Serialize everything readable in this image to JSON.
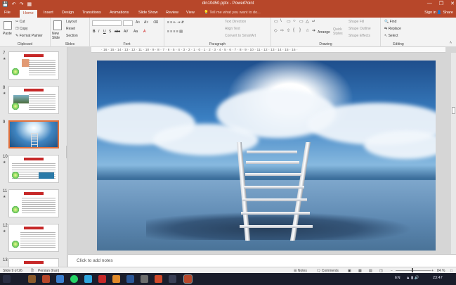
{
  "window": {
    "title": "din10d50.pptx - PowerPoint",
    "controls": [
      "—",
      "❐",
      "✕"
    ]
  },
  "tabs": [
    "File",
    "Home",
    "Insert",
    "Design",
    "Transitions",
    "Animations",
    "Slide Show",
    "Review",
    "View"
  ],
  "tell_me": "Tell me what you want to do...",
  "account": {
    "signin": "Sign in",
    "share": "Share"
  },
  "ribbon": {
    "clipboard": {
      "paste": "Paste",
      "cut": "Cut",
      "copy": "Copy",
      "format_painter": "Format Painter",
      "label": "Clipboard"
    },
    "slides": {
      "new_slide": "New Slide",
      "layout": "Layout",
      "reset": "Reset",
      "section": "Section",
      "label": "Slides"
    },
    "font": {
      "bold": "B",
      "italic": "I",
      "underline": "U",
      "strike": "S",
      "shadow": "abc",
      "spacing": "AV",
      "case": "Aa",
      "label": "Font"
    },
    "paragraph": {
      "text_direction": "Text Direction",
      "align_text": "Align Text",
      "smartart": "Convert to SmartArt",
      "label": "Paragraph"
    },
    "drawing": {
      "arrange": "Arrange",
      "quick_styles": "Quick Styles",
      "shape_fill": "Shape Fill",
      "shape_outline": "Shape Outline",
      "shape_effects": "Shape Effects",
      "label": "Drawing"
    },
    "editing": {
      "find": "Find",
      "replace": "Replace",
      "select": "Select",
      "label": "Editing"
    }
  },
  "ruler_text": "· 16 · 15 · 14 · 13 · 12 · 11 · 10 · 9 · 8 · 7 · 6 · 5 · 4 · 3 · 2 · 1 · 0 · 1 · 2 · 3 · 4 · 5 · 6 · 7 · 8 · 9 · 10 · 11 · 12 · 13 · 14 · 15 · 16 ·",
  "thumbnails": [
    "7",
    "8",
    "9",
    "10",
    "11",
    "12",
    "13"
  ],
  "selected_slide": "9",
  "notes_placeholder": "Click to add notes",
  "status": {
    "slide_info": "Slide 9 of 26",
    "language": "Persian (Iran)",
    "notes": "Notes",
    "comments": "Comments",
    "zoom": "84 %"
  },
  "taskbar": {
    "lang": "EN",
    "clock": "23:47"
  },
  "icons": [
    "save-icon",
    "undo-icon",
    "redo-icon",
    "present-icon",
    "paste-icon",
    "cut-icon",
    "copy-icon",
    "format-painter-icon",
    "new-slide-icon",
    "find-icon",
    "replace-icon",
    "select-icon",
    "shapes-icon",
    "notes-icon",
    "comments-icon",
    "normal-view-icon",
    "sorter-view-icon",
    "reading-view-icon",
    "slideshow-icon",
    "fit-icon"
  ],
  "colors": {
    "accent": "#b7472a",
    "selection": "#e0703c",
    "taskbar": "#1a1d2b"
  }
}
